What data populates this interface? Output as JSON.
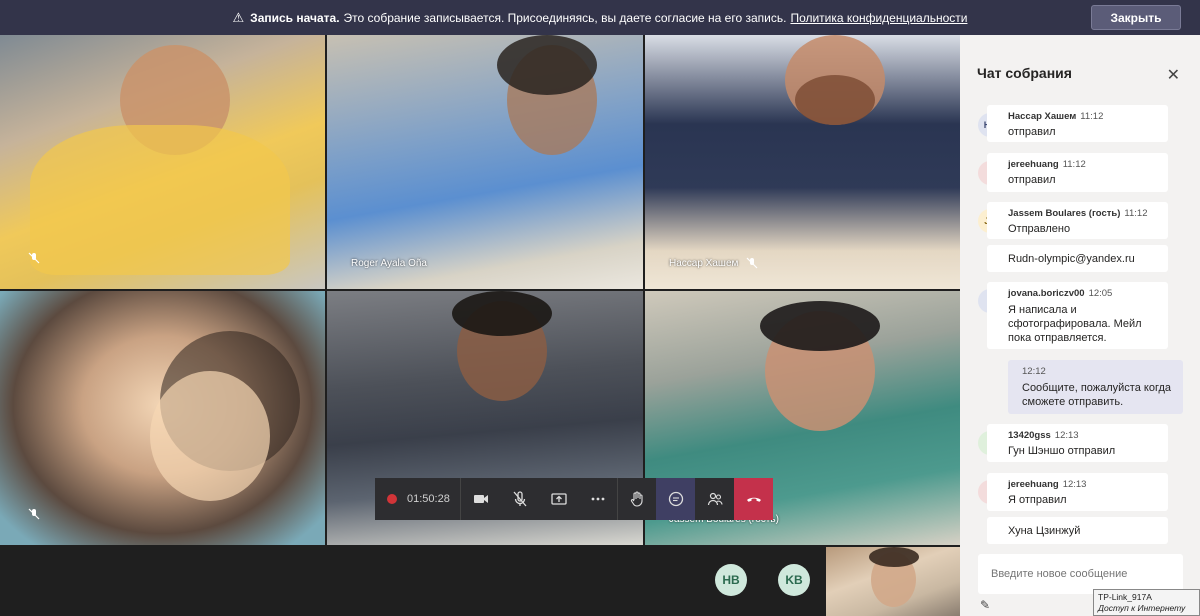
{
  "banner": {
    "icon": "warning-icon",
    "bold": "Запись начата.",
    "text": "Это собрание записывается. Присоединяясь, вы даете согласие на его запись.",
    "link": "Политика конфиденциальности",
    "close_label": "Закрыть",
    "bg_color": "#33344a"
  },
  "tiles": [
    {
      "name": "",
      "muted": true
    },
    {
      "name": "Roger Ayala Oña",
      "muted": false
    },
    {
      "name": "Нассар Хашем",
      "muted": true
    },
    {
      "name": "",
      "muted": true
    },
    {
      "name": "",
      "muted": false
    },
    {
      "name": "Jassem Boulares (гость)",
      "muted": false
    }
  ],
  "controls": {
    "timer": "01:50:28",
    "items": [
      "camera-icon",
      "mic-off-icon",
      "share-screen-icon",
      "more-icon",
      "raise-hand-icon",
      "chat-icon",
      "participants-icon",
      "hangup-icon"
    ]
  },
  "bottom": {
    "avatars": [
      "HB",
      "KB"
    ]
  },
  "chat": {
    "title": "Чат собрания",
    "messages": [
      {
        "initials": "HX",
        "author": "Нассар Хашем",
        "time": "11:12",
        "text": "отправил"
      },
      {
        "initials": "J",
        "author": "jereehuang",
        "time": "11:12",
        "text": "отправил"
      },
      {
        "initials": "JB",
        "author": "Jassem Boulares (гость)",
        "time": "11:12",
        "text": "Отправлено"
      },
      {
        "text": "Rudn-olympic@yandex.ru"
      },
      {
        "initials": "J",
        "author": "jovana.boriczv00",
        "time": "12:05",
        "text": "Я написала и сфотографировала. Мейл пока отправляется."
      },
      {
        "time": "12:12",
        "text": "Сообщите, пожалуйста когда сможете отправить."
      },
      {
        "initials": "1",
        "author": "13420gss",
        "time": "12:13",
        "text": "Гун Шэншо отправил"
      },
      {
        "initials": "J",
        "author": "jereehuang",
        "time": "12:13",
        "text": "Я отправил"
      },
      {
        "text": "Хуна Цзинжуй"
      }
    ],
    "compose_placeholder": "Введите новое сообщение"
  },
  "tooltip": {
    "line1": "TP-Link_917A",
    "line2": "Доступ к Интернету"
  }
}
